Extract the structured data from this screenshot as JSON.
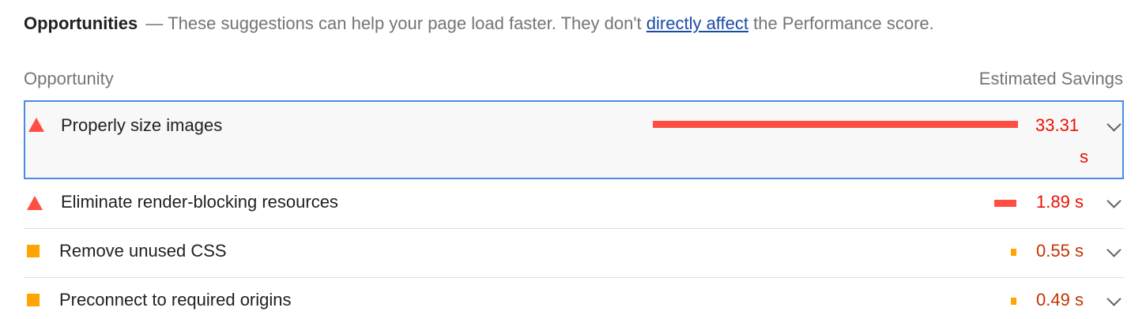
{
  "group": {
    "title": "Opportunities",
    "separator": "—",
    "description_before": "These suggestions can help your page load faster. They don't",
    "link_text": "directly affect",
    "description_after": "the Performance score."
  },
  "columns": {
    "opportunity": "Opportunity",
    "savings": "Estimated Savings"
  },
  "colors": {
    "fail": "#ff4e42",
    "fail_text": "#eb0f00",
    "average": "#ffa400",
    "average_text": "#c33300",
    "link": "#1a4ba5",
    "focus_border": "#4a8ae6"
  },
  "audits": [
    {
      "title": "Properly size images",
      "rating": "fail",
      "icon": "triangle-warning-icon",
      "savings_value": "33.31",
      "savings_unit": "s",
      "bar_fraction": 1.0,
      "expanded": true
    },
    {
      "title": "Eliminate render-blocking resources",
      "rating": "fail",
      "icon": "triangle-warning-icon",
      "savings_value": "1.89",
      "savings_unit": "s",
      "bar_fraction": 0.057,
      "expanded": false
    },
    {
      "title": "Remove unused CSS",
      "rating": "average",
      "icon": "square-average-icon",
      "savings_value": "0.55",
      "savings_unit": "s",
      "bar_fraction": 0.017,
      "expanded": false
    },
    {
      "title": "Preconnect to required origins",
      "rating": "average",
      "icon": "square-average-icon",
      "savings_value": "0.49",
      "savings_unit": "s",
      "bar_fraction": 0.015,
      "expanded": false
    }
  ]
}
